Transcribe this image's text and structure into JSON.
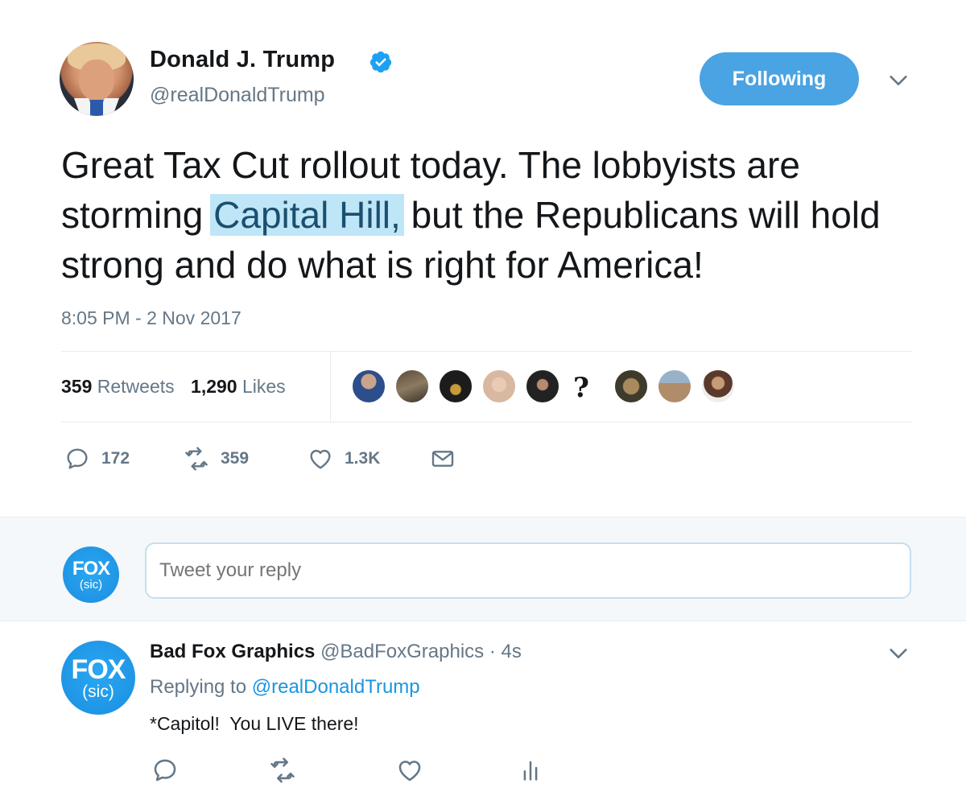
{
  "tweet": {
    "display_name": "Donald J. Trump",
    "handle": "@realDonaldTrump",
    "follow_label": "Following",
    "text_before": "Great Tax Cut rollout today. The lobbyists are storming ",
    "text_highlight": "Capital Hill,",
    "text_after": " but the Republicans will hold strong and do what is right for America!",
    "timestamp": "8:05 PM - 2 Nov 2017",
    "stats": {
      "retweets_count": "359",
      "retweets_label": "Retweets",
      "likes_count": "1,290",
      "likes_label": "Likes"
    },
    "likers_question_glyph": "?",
    "actions": {
      "reply_count": "172",
      "retweet_count": "359",
      "like_count": "1.3K"
    },
    "icons": {
      "verified": "verified-badge-icon",
      "caret": "chevron-down-icon",
      "reply": "reply-icon",
      "retweet": "retweet-icon",
      "like": "heart-icon",
      "dm": "envelope-icon",
      "analytics": "analytics-icon"
    },
    "colors": {
      "accent": "#4aa3e2",
      "highlight_bg": "#bfe6f7",
      "muted": "#657786",
      "link": "#1b95e0"
    }
  },
  "compose": {
    "avatar_word": "FOX",
    "avatar_sub": "(sic)",
    "placeholder": "Tweet your reply"
  },
  "reply": {
    "avatar_word": "FOX",
    "avatar_sub": "(sic)",
    "display_name": "Bad Fox Graphics",
    "handle": "@BadFoxGraphics",
    "separator": "·",
    "age": "4s",
    "replying_label": "Replying to",
    "replying_handle": "@realDonaldTrump",
    "text": "*Capitol!  You LIVE there!"
  }
}
